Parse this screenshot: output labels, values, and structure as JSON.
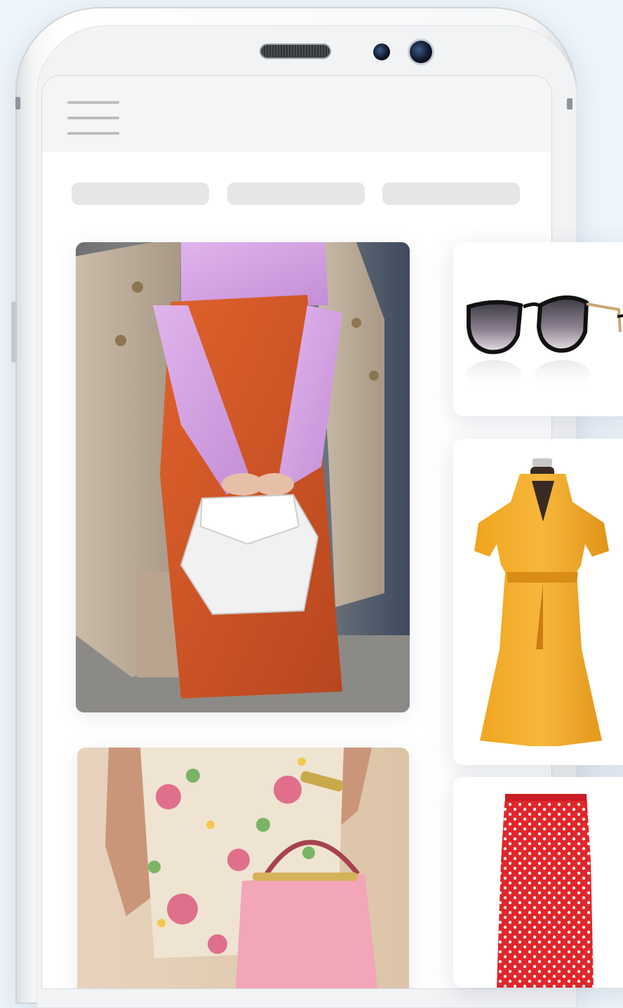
{
  "icons": {
    "menu": "hamburger-menu-icon"
  },
  "nav": {
    "tabs": [
      "",
      "",
      ""
    ]
  },
  "feed": {
    "items": [
      "street-style-outfit-photo",
      "floral-skirt-pink-bag-photo"
    ]
  },
  "products": {
    "items": [
      "cat-eye-sunglasses",
      "yellow-wrap-dress",
      "red-polka-dot-skirt"
    ]
  },
  "colors": {
    "background": "#eef5fb",
    "appbar": "#f5f5f5",
    "placeholder": "#e6e6e6",
    "menu_lines": "#bdbdbd"
  }
}
